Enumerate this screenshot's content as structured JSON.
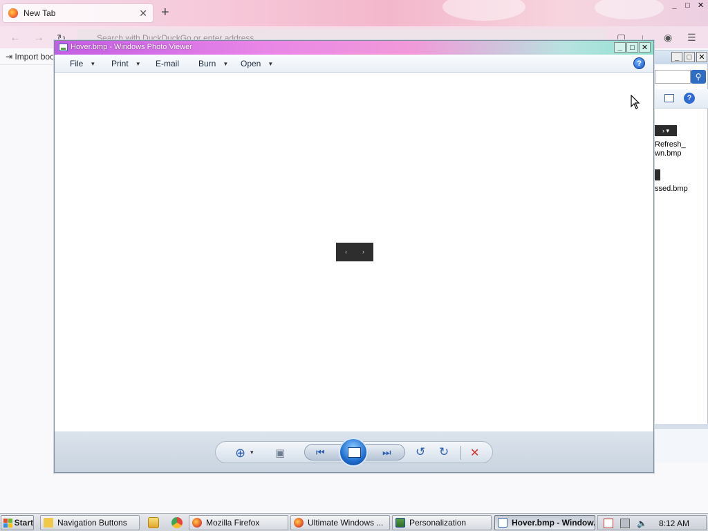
{
  "firefox": {
    "tab_title": "New Tab",
    "tab_close": "✕",
    "new_tab": "+",
    "url_placeholder": "Search with DuckDuckGo or enter address",
    "bookmark_import": "Import boo",
    "win_min": "_",
    "win_max": "□",
    "win_close": "✕"
  },
  "explorer": {
    "files": [
      "Refresh_",
      "wn.bmp",
      "ssed.bmp"
    ],
    "search_icon": "search-icon",
    "help_label": "?"
  },
  "photo_viewer": {
    "title": "Hover.bmp - Windows Photo Viewer",
    "menu": [
      {
        "label": "File",
        "has_dropdown": true
      },
      {
        "label": "Print",
        "has_dropdown": true
      },
      {
        "label": "E-mail",
        "has_dropdown": false
      },
      {
        "label": "Burn",
        "has_dropdown": true
      },
      {
        "label": "Open",
        "has_dropdown": true
      }
    ],
    "help_label": "?",
    "win_min": "_",
    "win_max": "□",
    "win_close": "✕",
    "mini_prev": "‹",
    "mini_next": "›",
    "controls": {
      "zoom": "⊕",
      "zoom_caret": "▾",
      "actual_size": "▣",
      "previous": "⏮",
      "next": "⏭",
      "rotate_ccw": "↺",
      "rotate_cw": "↻",
      "delete": "✕"
    }
  },
  "taskbar": {
    "start_label": "Start",
    "tasks": [
      {
        "label": "Navigation Buttons",
        "icon_color": "#f0c84a"
      },
      {
        "label": "Mozilla Firefox",
        "icon_color": "#e8622c"
      },
      {
        "label": "Ultimate Windows ...",
        "icon_color": "#e8622c"
      },
      {
        "label": "Personalization",
        "icon_color": "#3b7d3b"
      },
      {
        "label": "Hover.bmp - Window...",
        "icon_color": "#3a67ad",
        "active": true
      }
    ],
    "clock": "8:12 AM"
  },
  "colors": {
    "photo_viewer_title_start": "#c25ee4",
    "photo_viewer_title_end": "#8fe2d0",
    "delete_red": "#d42a2a",
    "control_blue": "#2d5fb0"
  }
}
